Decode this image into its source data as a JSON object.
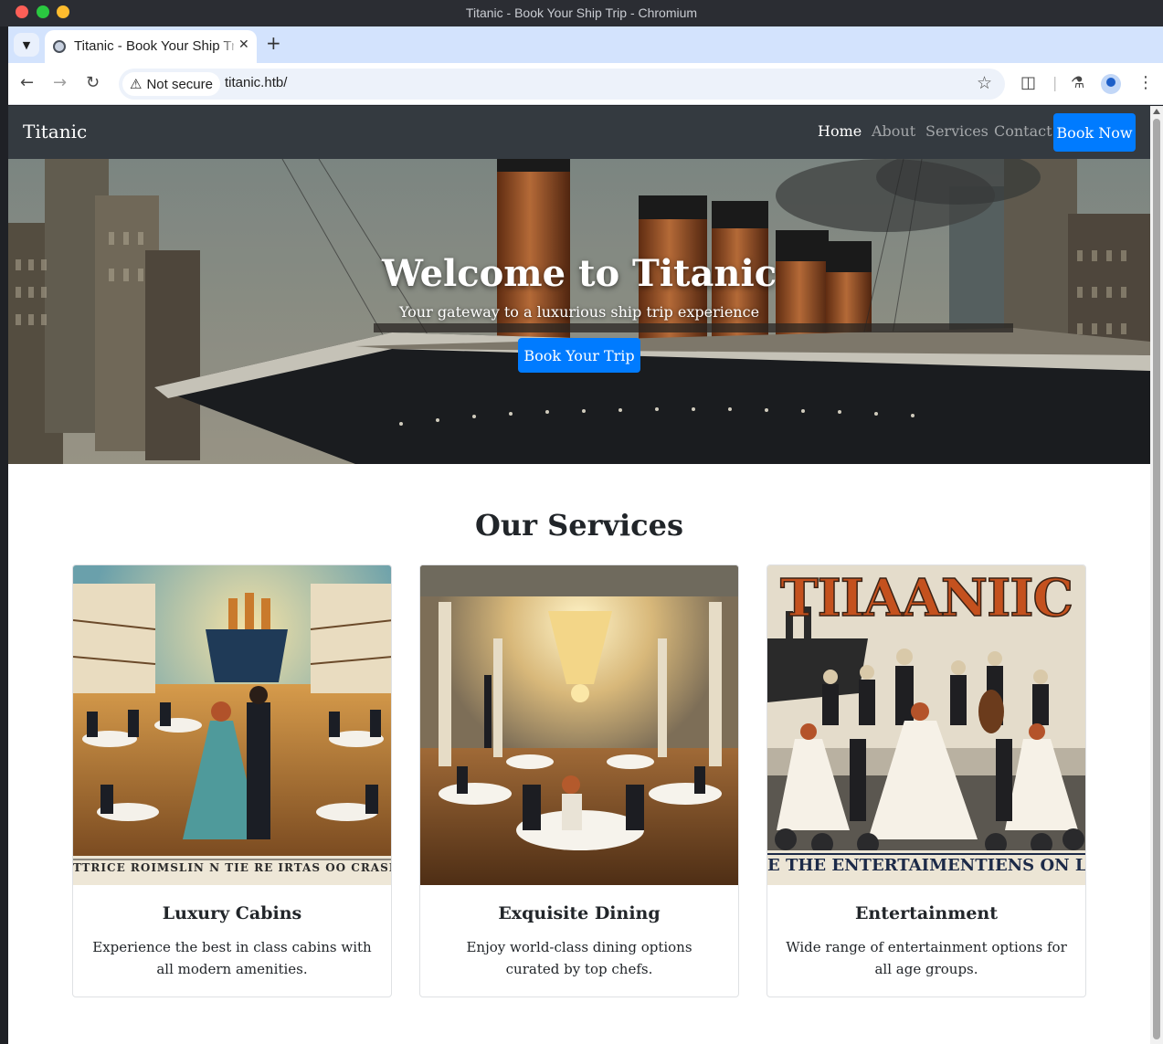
{
  "window": {
    "title": "Titanic - Book Your Ship Trip - Chromium"
  },
  "browser": {
    "tab_title": "Titanic - Book Your Ship Trip",
    "security_label": "Not secure",
    "url": "titanic.htb/"
  },
  "navbar": {
    "brand": "Titanic",
    "links": [
      "Home",
      "About",
      "Services",
      "Contact"
    ],
    "active": "Home",
    "cta": "Book Now"
  },
  "hero": {
    "title": "Welcome to Titanic",
    "subtitle": "Your gateway to a luxurious ship trip experience",
    "button": "Book Your Trip"
  },
  "services": {
    "heading": "Our Services",
    "cards": [
      {
        "title": "Luxury Cabins",
        "text": "Experience the best in class cabins with all modern amenities.",
        "image_caption": "TTRICE ROIMSLIN N TIE RE IRTAS OO CRASI"
      },
      {
        "title": "Exquisite Dining",
        "text": "Enjoy world-class dining options curated by top chefs."
      },
      {
        "title": "Entertainment",
        "text": "Wide range of entertainment options for all age groups.",
        "image_header": "TIIAANIIC",
        "image_caption": "E THE ENTERTAIMENTIENS ON LAI"
      }
    ]
  },
  "colors": {
    "navbar_bg": "#343a40",
    "primary": "#007bff",
    "text": "#212529"
  }
}
